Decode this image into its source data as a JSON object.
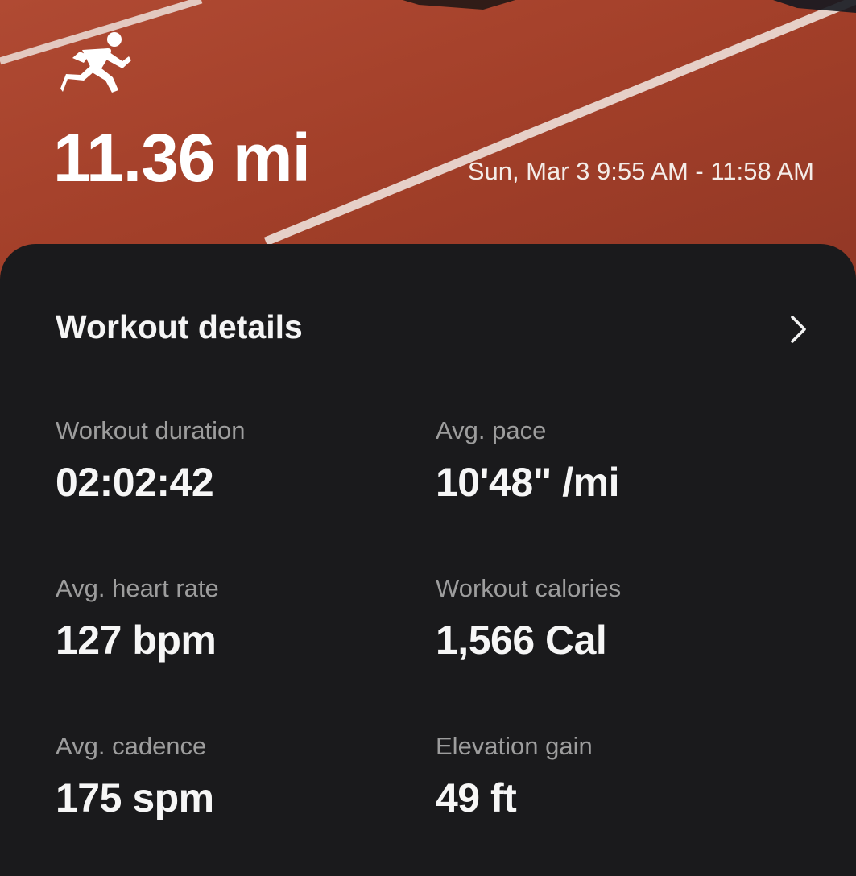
{
  "hero": {
    "icon": "running-person-icon",
    "distance": "11.36 mi",
    "time_range": "Sun, Mar 3 9:55 AM - 11:58 AM"
  },
  "details": {
    "title": "Workout details",
    "chevron_icon": "chevron-right-icon",
    "stats": [
      {
        "label": "Workout duration",
        "value": "02:02:42"
      },
      {
        "label": "Avg. pace",
        "value": "10'48\" /mi"
      },
      {
        "label": "Avg. heart rate",
        "value": "127 bpm"
      },
      {
        "label": "Workout calories",
        "value": "1,566 Cal"
      },
      {
        "label": "Avg. cadence",
        "value": "175 spm"
      },
      {
        "label": "Elevation gain",
        "value": "49 ft"
      }
    ]
  },
  "colors": {
    "track": "#a4402a",
    "card_background": "#1a1a1c",
    "label_text": "#9d9d9d",
    "value_text": "#f6f6f6"
  }
}
